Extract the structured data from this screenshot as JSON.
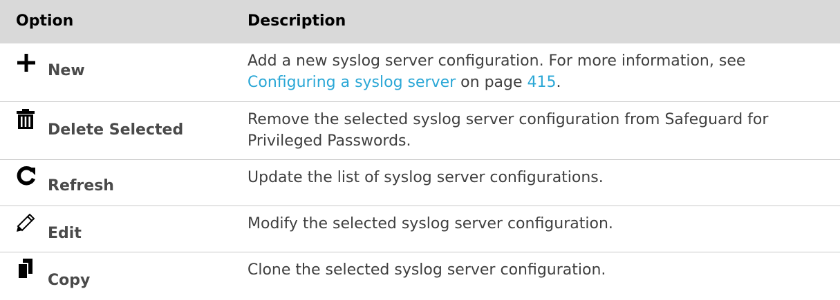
{
  "header": {
    "option": "Option",
    "description": "Description"
  },
  "rows": [
    {
      "icon": "plus-icon",
      "label": "New",
      "description_pre": "Add a new syslog server configuration. For more information, see ",
      "link_text": "Configuring a syslog server",
      "description_mid": " on page ",
      "page_link": "415",
      "description_post": "."
    },
    {
      "icon": "trash-icon",
      "label": "Delete Selected",
      "description": "Remove the selected syslog server configuration from Safeguard for Privileged Passwords."
    },
    {
      "icon": "refresh-icon",
      "label": "Refresh",
      "description": "Update the list of syslog server configurations."
    },
    {
      "icon": "pencil-icon",
      "label": "Edit",
      "description": "Modify the selected syslog server configuration."
    },
    {
      "icon": "copy-icon",
      "label": "Copy",
      "description": "Clone the selected syslog server configuration."
    }
  ],
  "colors": {
    "header_bg": "#d9d9d9",
    "link": "#2aa7d6",
    "text": "#3f3f3f",
    "divider": "#c8c8c8"
  }
}
